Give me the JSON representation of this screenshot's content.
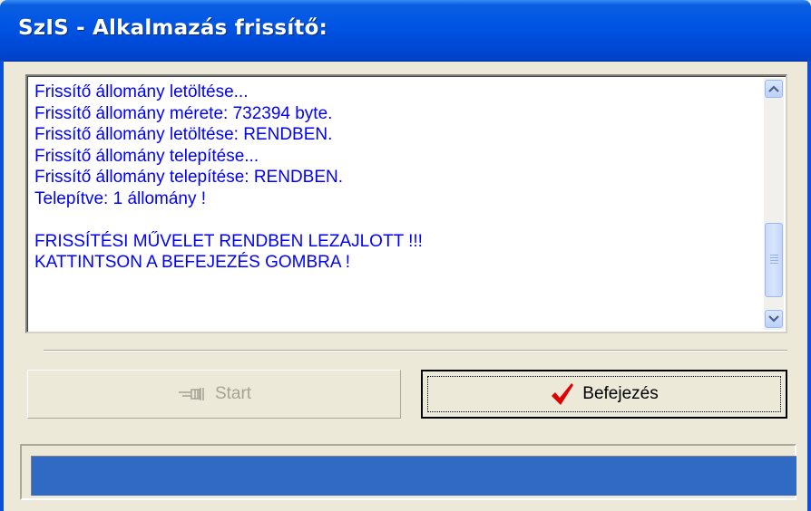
{
  "window": {
    "title": "SzIS - Alkalmazás frissítő:",
    "title_bar_color": "#0055e5",
    "face_color": "#ece9d8"
  },
  "log": {
    "text_color": "#0000ff",
    "lines": [
      "Frissítő állomány letöltése...",
      "Frissítő állomány mérete: 732394 byte.",
      "Frissítő állomány letöltése: RENDBEN.",
      "Frissítő állomány telepítése...",
      "Frissítő állomány telepítése: RENDBEN.",
      "Telepítve: 1 állomány !",
      "",
      "FRISSÍTÉSI MŰVELET RENDBEN LEZAJLOTT !!!",
      "KATTINTSON A BEFEJEZÉS GOMBRA !"
    ]
  },
  "buttons": {
    "start": {
      "label": "Start",
      "icon": "pointing-hand-icon",
      "enabled": false
    },
    "finish": {
      "label": "Befejezés",
      "icon": "checkmark-icon",
      "icon_color": "#e00000",
      "enabled": true
    }
  },
  "status": {
    "progress": 1.0,
    "color": "#316ac5"
  }
}
